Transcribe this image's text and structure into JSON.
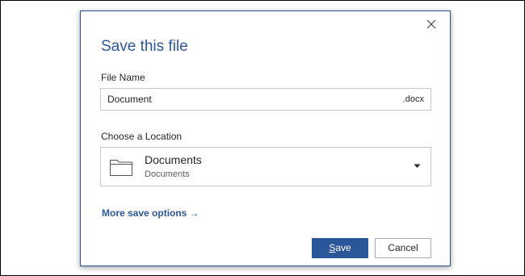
{
  "dialog": {
    "title": "Save this file",
    "close_icon": "close-icon",
    "file_name": {
      "label": "File Name",
      "value": "Document",
      "extension": ".docx"
    },
    "location": {
      "label": "Choose a Location",
      "selected_name": "Documents",
      "selected_sub": "Documents",
      "icon": "folder-icon",
      "dropdown_icon": "caret-down-icon"
    },
    "more_options": {
      "label": "More save options",
      "arrow": "→"
    },
    "buttons": {
      "save_mnemonic": "S",
      "save_rest": "ave",
      "cancel": "Cancel"
    }
  },
  "colors": {
    "accent": "#2b579a",
    "text": "#262626",
    "border": "#c6c6c6"
  }
}
